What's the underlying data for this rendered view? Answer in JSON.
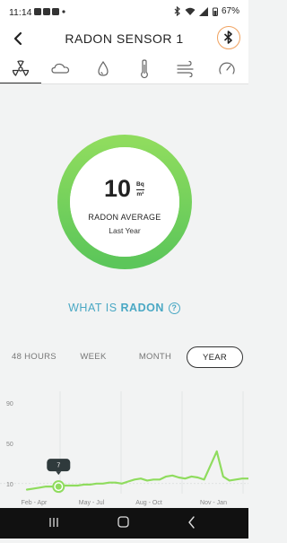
{
  "status_bar": {
    "time": "11:14",
    "notifications": "•",
    "battery": "67%"
  },
  "header": {
    "title": "RADON SENSOR 1"
  },
  "tabs": [
    {
      "icon": "radiation-icon",
      "active": true
    },
    {
      "icon": "cloud-icon",
      "active": false
    },
    {
      "icon": "droplet-icon",
      "active": false
    },
    {
      "icon": "thermometer-icon",
      "active": false
    },
    {
      "icon": "wind-icon",
      "active": false
    },
    {
      "icon": "gauge-icon",
      "active": false
    }
  ],
  "summary": {
    "value": "10",
    "unit_top": "Bq",
    "unit_bottom": "m³",
    "label": "RADON AVERAGE",
    "sublabel": "Last Year"
  },
  "what_is": {
    "prefix": "WHAT IS ",
    "highlight": "RADON",
    "help_icon": "?"
  },
  "periods": {
    "p48": "48 HOURS",
    "week": "WEEK",
    "month": "MONTH",
    "year": "YEAR",
    "active": "YEAR"
  },
  "colors": {
    "accent": "#4aa8c4",
    "ring_green": "#7ed957",
    "line_green": "#8fdc5e"
  },
  "chart_data": {
    "type": "line",
    "y_ticks": [
      "90",
      "50",
      "10"
    ],
    "x_labels": [
      "Feb - Apr",
      "May - Jul",
      "Aug - Oct",
      "Nov - Jan"
    ],
    "ylim": [
      0,
      90
    ],
    "tooltip": "7",
    "series": [
      {
        "values": [
          4,
          5,
          6,
          7,
          7,
          7,
          8,
          8,
          8,
          9,
          9,
          10,
          10,
          11,
          11,
          10,
          12,
          14,
          15,
          13,
          14,
          14,
          17,
          18,
          16,
          15,
          17,
          16,
          14,
          28,
          42,
          17,
          13,
          14,
          15,
          15
        ]
      }
    ]
  }
}
